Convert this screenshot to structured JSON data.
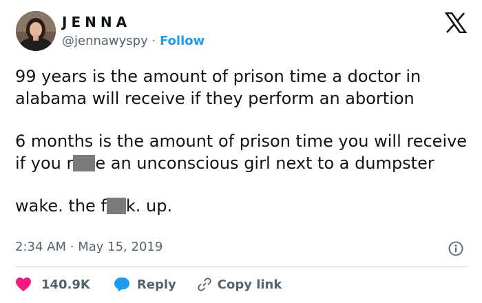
{
  "author": {
    "name": "JENNA",
    "handle": "@jennawyspy",
    "separator": "·",
    "follow_label": "Follow"
  },
  "tweet": {
    "para1": "99 years is the amount of prison time a doctor in alabama will receive if they perform an abortion",
    "para2_part1": "6 months is the amount of prison time you will receive if you r",
    "para2_part2": "e an unconscious girl next to a dumpster",
    "para3_part1": "wake. the f",
    "para3_part2": "k. up."
  },
  "meta": {
    "time": "2:34 AM",
    "separator": "·",
    "date": "May 15, 2019"
  },
  "actions": {
    "likes": "140.9K",
    "reply_label": "Reply",
    "copy_label": "Copy link"
  },
  "icons": {
    "platform": "x-logo-icon",
    "info": "info-icon",
    "like": "heart-icon",
    "reply": "chat-bubble-icon",
    "copy": "link-icon"
  },
  "colors": {
    "accent": "#1d9bf0",
    "like": "#f91880",
    "text": "#0f1419",
    "muted": "#536471",
    "redaction": "#7a7a7a"
  }
}
